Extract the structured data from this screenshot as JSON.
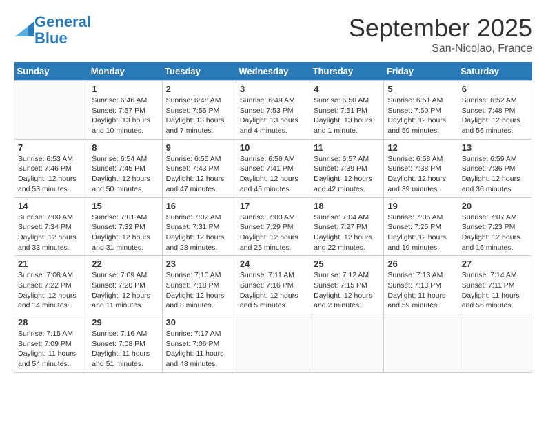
{
  "header": {
    "logo_line1": "General",
    "logo_line2": "Blue",
    "month_title": "September 2025",
    "location": "San-Nicolao, France"
  },
  "weekdays": [
    "Sunday",
    "Monday",
    "Tuesday",
    "Wednesday",
    "Thursday",
    "Friday",
    "Saturday"
  ],
  "weeks": [
    [
      {
        "day": "",
        "sunrise": "",
        "sunset": "",
        "daylight": ""
      },
      {
        "day": "1",
        "sunrise": "Sunrise: 6:46 AM",
        "sunset": "Sunset: 7:57 PM",
        "daylight": "Daylight: 13 hours and 10 minutes."
      },
      {
        "day": "2",
        "sunrise": "Sunrise: 6:48 AM",
        "sunset": "Sunset: 7:55 PM",
        "daylight": "Daylight: 13 hours and 7 minutes."
      },
      {
        "day": "3",
        "sunrise": "Sunrise: 6:49 AM",
        "sunset": "Sunset: 7:53 PM",
        "daylight": "Daylight: 13 hours and 4 minutes."
      },
      {
        "day": "4",
        "sunrise": "Sunrise: 6:50 AM",
        "sunset": "Sunset: 7:51 PM",
        "daylight": "Daylight: 13 hours and 1 minute."
      },
      {
        "day": "5",
        "sunrise": "Sunrise: 6:51 AM",
        "sunset": "Sunset: 7:50 PM",
        "daylight": "Daylight: 12 hours and 59 minutes."
      },
      {
        "day": "6",
        "sunrise": "Sunrise: 6:52 AM",
        "sunset": "Sunset: 7:48 PM",
        "daylight": "Daylight: 12 hours and 56 minutes."
      }
    ],
    [
      {
        "day": "7",
        "sunrise": "Sunrise: 6:53 AM",
        "sunset": "Sunset: 7:46 PM",
        "daylight": "Daylight: 12 hours and 53 minutes."
      },
      {
        "day": "8",
        "sunrise": "Sunrise: 6:54 AM",
        "sunset": "Sunset: 7:45 PM",
        "daylight": "Daylight: 12 hours and 50 minutes."
      },
      {
        "day": "9",
        "sunrise": "Sunrise: 6:55 AM",
        "sunset": "Sunset: 7:43 PM",
        "daylight": "Daylight: 12 hours and 47 minutes."
      },
      {
        "day": "10",
        "sunrise": "Sunrise: 6:56 AM",
        "sunset": "Sunset: 7:41 PM",
        "daylight": "Daylight: 12 hours and 45 minutes."
      },
      {
        "day": "11",
        "sunrise": "Sunrise: 6:57 AM",
        "sunset": "Sunset: 7:39 PM",
        "daylight": "Daylight: 12 hours and 42 minutes."
      },
      {
        "day": "12",
        "sunrise": "Sunrise: 6:58 AM",
        "sunset": "Sunset: 7:38 PM",
        "daylight": "Daylight: 12 hours and 39 minutes."
      },
      {
        "day": "13",
        "sunrise": "Sunrise: 6:59 AM",
        "sunset": "Sunset: 7:36 PM",
        "daylight": "Daylight: 12 hours and 36 minutes."
      }
    ],
    [
      {
        "day": "14",
        "sunrise": "Sunrise: 7:00 AM",
        "sunset": "Sunset: 7:34 PM",
        "daylight": "Daylight: 12 hours and 33 minutes."
      },
      {
        "day": "15",
        "sunrise": "Sunrise: 7:01 AM",
        "sunset": "Sunset: 7:32 PM",
        "daylight": "Daylight: 12 hours and 31 minutes."
      },
      {
        "day": "16",
        "sunrise": "Sunrise: 7:02 AM",
        "sunset": "Sunset: 7:31 PM",
        "daylight": "Daylight: 12 hours and 28 minutes."
      },
      {
        "day": "17",
        "sunrise": "Sunrise: 7:03 AM",
        "sunset": "Sunset: 7:29 PM",
        "daylight": "Daylight: 12 hours and 25 minutes."
      },
      {
        "day": "18",
        "sunrise": "Sunrise: 7:04 AM",
        "sunset": "Sunset: 7:27 PM",
        "daylight": "Daylight: 12 hours and 22 minutes."
      },
      {
        "day": "19",
        "sunrise": "Sunrise: 7:05 AM",
        "sunset": "Sunset: 7:25 PM",
        "daylight": "Daylight: 12 hours and 19 minutes."
      },
      {
        "day": "20",
        "sunrise": "Sunrise: 7:07 AM",
        "sunset": "Sunset: 7:23 PM",
        "daylight": "Daylight: 12 hours and 16 minutes."
      }
    ],
    [
      {
        "day": "21",
        "sunrise": "Sunrise: 7:08 AM",
        "sunset": "Sunset: 7:22 PM",
        "daylight": "Daylight: 12 hours and 14 minutes."
      },
      {
        "day": "22",
        "sunrise": "Sunrise: 7:09 AM",
        "sunset": "Sunset: 7:20 PM",
        "daylight": "Daylight: 12 hours and 11 minutes."
      },
      {
        "day": "23",
        "sunrise": "Sunrise: 7:10 AM",
        "sunset": "Sunset: 7:18 PM",
        "daylight": "Daylight: 12 hours and 8 minutes."
      },
      {
        "day": "24",
        "sunrise": "Sunrise: 7:11 AM",
        "sunset": "Sunset: 7:16 PM",
        "daylight": "Daylight: 12 hours and 5 minutes."
      },
      {
        "day": "25",
        "sunrise": "Sunrise: 7:12 AM",
        "sunset": "Sunset: 7:15 PM",
        "daylight": "Daylight: 12 hours and 2 minutes."
      },
      {
        "day": "26",
        "sunrise": "Sunrise: 7:13 AM",
        "sunset": "Sunset: 7:13 PM",
        "daylight": "Daylight: 11 hours and 59 minutes."
      },
      {
        "day": "27",
        "sunrise": "Sunrise: 7:14 AM",
        "sunset": "Sunset: 7:11 PM",
        "daylight": "Daylight: 11 hours and 56 minutes."
      }
    ],
    [
      {
        "day": "28",
        "sunrise": "Sunrise: 7:15 AM",
        "sunset": "Sunset: 7:09 PM",
        "daylight": "Daylight: 11 hours and 54 minutes."
      },
      {
        "day": "29",
        "sunrise": "Sunrise: 7:16 AM",
        "sunset": "Sunset: 7:08 PM",
        "daylight": "Daylight: 11 hours and 51 minutes."
      },
      {
        "day": "30",
        "sunrise": "Sunrise: 7:17 AM",
        "sunset": "Sunset: 7:06 PM",
        "daylight": "Daylight: 11 hours and 48 minutes."
      },
      {
        "day": "",
        "sunrise": "",
        "sunset": "",
        "daylight": ""
      },
      {
        "day": "",
        "sunrise": "",
        "sunset": "",
        "daylight": ""
      },
      {
        "day": "",
        "sunrise": "",
        "sunset": "",
        "daylight": ""
      },
      {
        "day": "",
        "sunrise": "",
        "sunset": "",
        "daylight": ""
      }
    ]
  ]
}
